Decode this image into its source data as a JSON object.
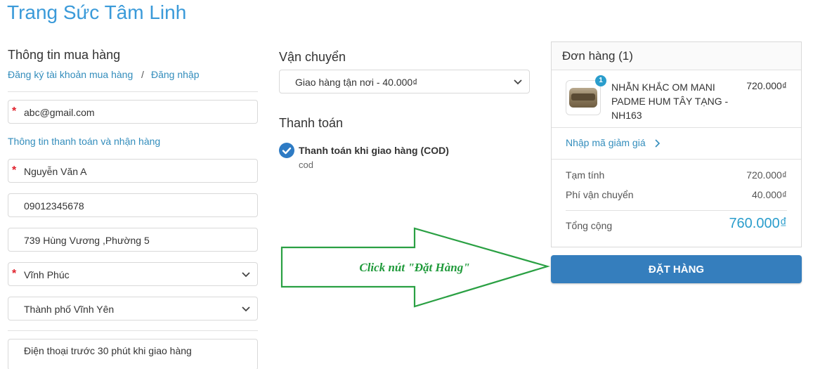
{
  "shop": {
    "title": "Trang Sức Tâm Linh"
  },
  "customer": {
    "heading": "Thông tin mua hàng",
    "register_link": "Đăng ký tài khoản mua hàng",
    "separator": "/",
    "login_link": "Đăng nhập",
    "email": "abc@gmail.com"
  },
  "billing": {
    "heading": "Thông tin thanh toán và nhận hàng",
    "full_name": "Nguyễn Văn A",
    "phone": "09012345678",
    "address": "739 Hùng Vương ,Phường 5",
    "province": "Vĩnh Phúc",
    "district": "Thành phố Vĩnh Yên",
    "note": "Điện thoại trước 30 phút khi giao hàng"
  },
  "shipping": {
    "heading": "Vận chuyển",
    "selected": "Giao hàng tận nơi - 40.000₫"
  },
  "payment": {
    "heading": "Thanh toán",
    "method": "Thanh toán khi giao hàng (COD)",
    "method_code": "cod"
  },
  "annotation": {
    "text": "Click nút \"Đặt Hàng\"",
    "color": "#1f9a3a"
  },
  "order": {
    "heading": "Đơn hàng (1)",
    "item": {
      "name": "NHẪN KHẮC OM MANI PADME HUM TÂY TẠNG - NH163",
      "price": "720.000₫",
      "quantity": "1"
    },
    "discount_link": "Nhập mã giảm giá",
    "subtotal_label": "Tạm tính",
    "subtotal": "720.000₫",
    "shipping_label": "Phí vận chuyển",
    "shipping_fee": "40.000₫",
    "total_label": "Tổng cộng",
    "total": "760.000₫"
  },
  "actions": {
    "place_order": "ĐẶT HÀNG"
  },
  "colors": {
    "accent": "#338dbc",
    "button": "#357ebd",
    "required": "#e0212c"
  }
}
